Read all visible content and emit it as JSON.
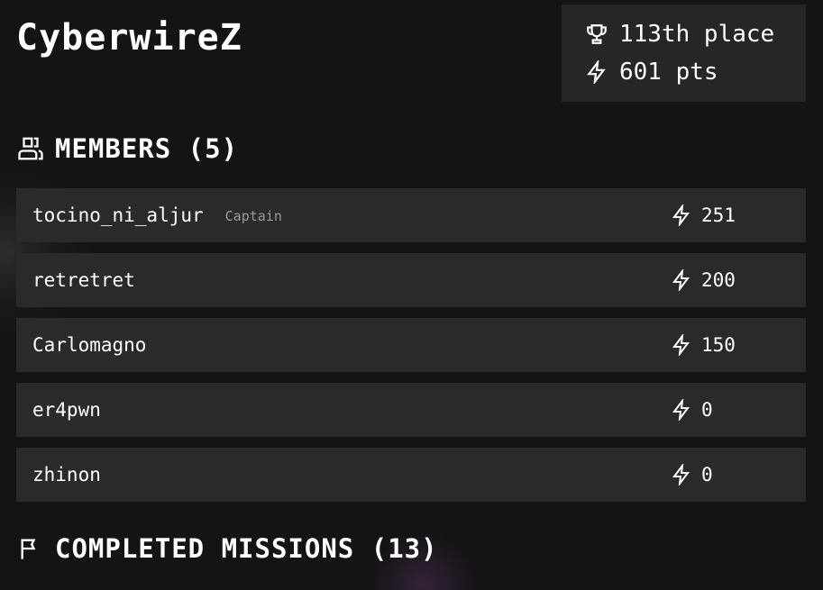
{
  "team": {
    "name": "CyberwireZ"
  },
  "stats": {
    "rank_text": "113th place",
    "rank_icon": "trophy-icon",
    "points_text": "601 pts",
    "points_icon": "bolt-icon"
  },
  "members_section": {
    "heading": "MEMBERS (5)",
    "icon": "users-icon",
    "members": [
      {
        "name": "tocino_ni_aljur",
        "role": "Captain",
        "points": "251"
      },
      {
        "name": "retretret",
        "role": "",
        "points": "200"
      },
      {
        "name": "Carlomagno",
        "role": "",
        "points": "150"
      },
      {
        "name": "er4pwn",
        "role": "",
        "points": "0"
      },
      {
        "name": "zhinon",
        "role": "",
        "points": "0"
      }
    ]
  },
  "missions_section": {
    "heading": "COMPLETED MISSIONS (13)",
    "icon": "flag-icon"
  },
  "colors": {
    "background": "#141414",
    "panel": "#2a2a2a",
    "stats_panel": "#262626",
    "text": "#ffffff",
    "muted": "#9a9a9a"
  }
}
